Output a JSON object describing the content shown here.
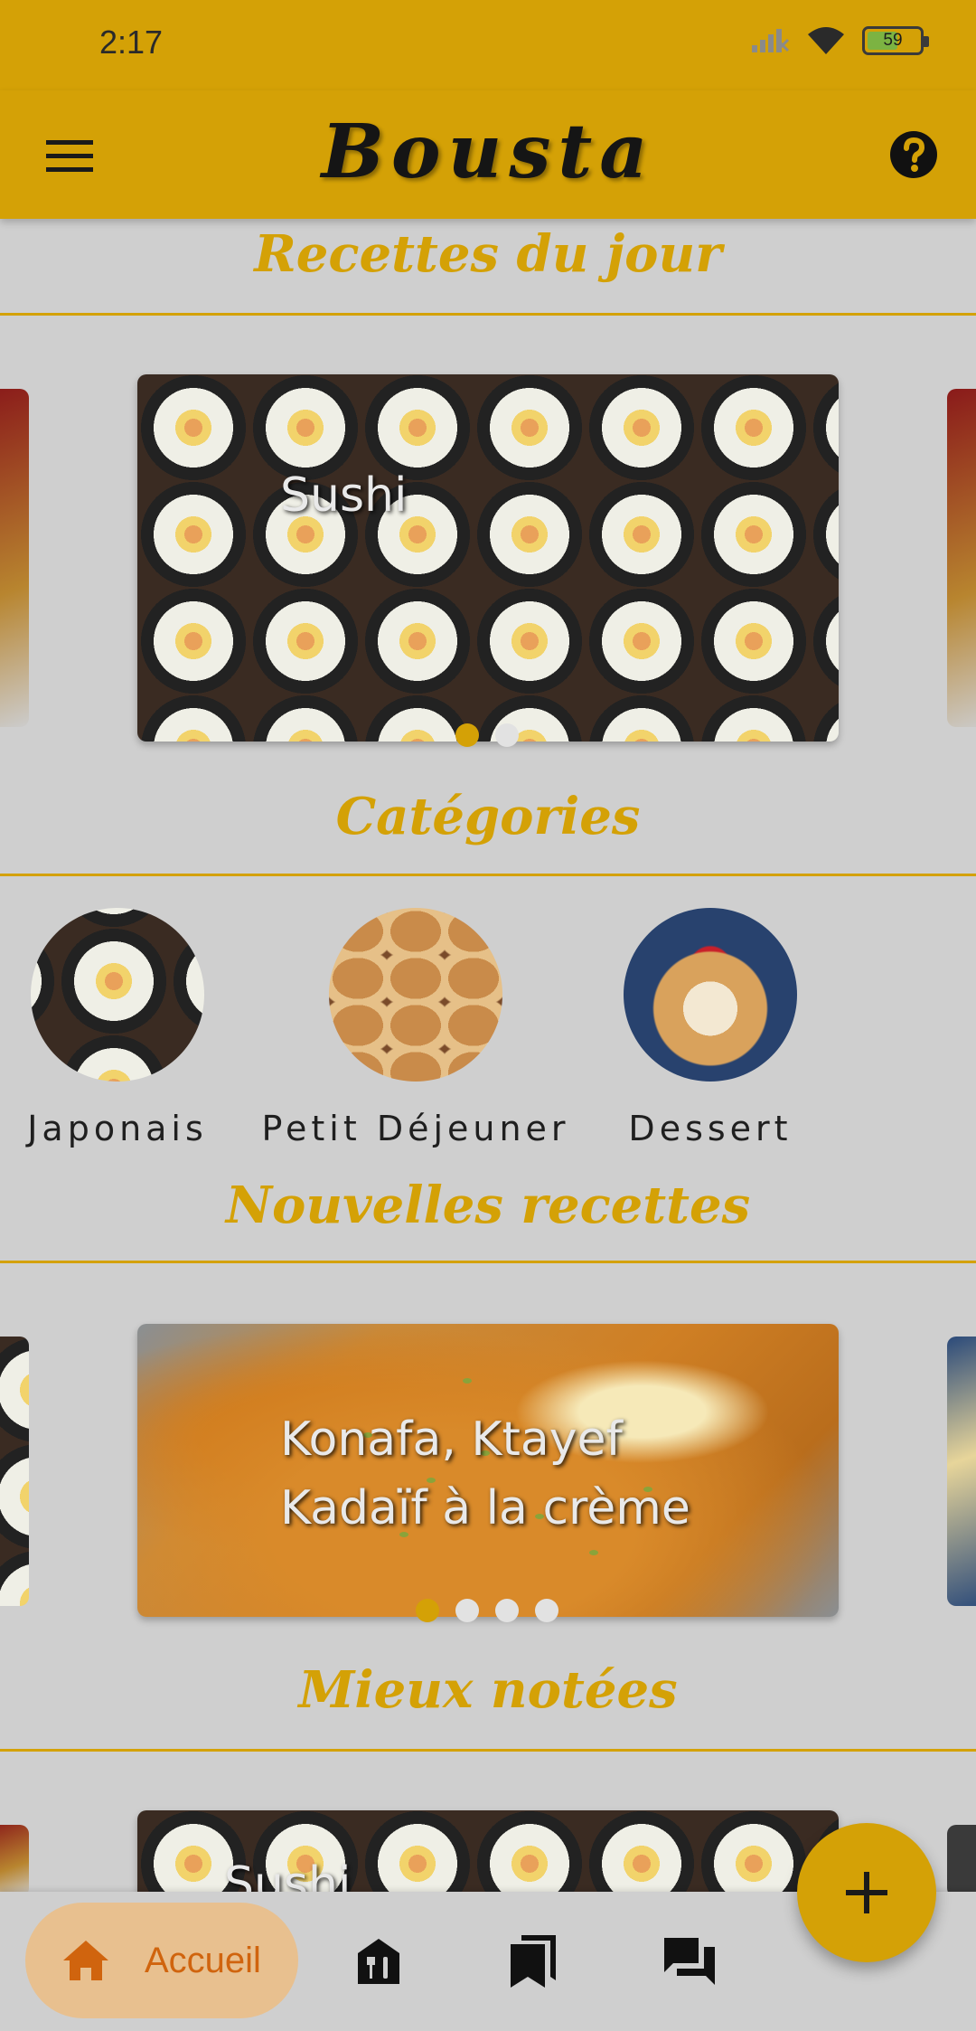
{
  "status_bar": {
    "time": "2:17",
    "battery_percent": "59",
    "battery_level": 0.59
  },
  "app_bar": {
    "title": "Bousta",
    "menu_icon": "hamburger-menu-icon",
    "help_icon": "help-circle-icon"
  },
  "sections": {
    "daily": {
      "title": "Recettes du jour",
      "card_caption": "Sushi",
      "page_count": 2,
      "active_page": 0
    },
    "categories": {
      "title": "Catégories",
      "items": [
        {
          "label": "Japonais"
        },
        {
          "label": "Petit Déjeuner"
        },
        {
          "label": "Dessert"
        }
      ]
    },
    "new": {
      "title": "Nouvelles recettes",
      "card_caption_line1": "Konafa, Ktayef",
      "card_caption_line2": "Kadaïf à la crème",
      "page_count": 4,
      "active_page": 0
    },
    "top_rated": {
      "title": "Mieux notées",
      "card_caption": "Sushi"
    }
  },
  "fab": {
    "icon": "plus-icon"
  },
  "bottom_nav": {
    "home_label": "Accueil",
    "items": [
      {
        "icon": "home-icon"
      },
      {
        "icon": "restaurant-icon"
      },
      {
        "icon": "bookmarks-icon"
      },
      {
        "icon": "forum-icon"
      }
    ]
  },
  "colors": {
    "primary": "#d4a106",
    "background": "#cfcfcf",
    "nav_active_bg": "#e8c08f",
    "nav_active_text": "#d0640e"
  }
}
